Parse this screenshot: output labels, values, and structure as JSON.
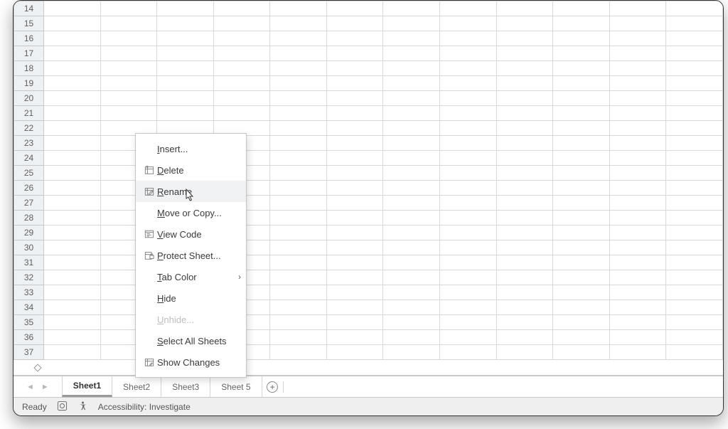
{
  "rows": [
    14,
    15,
    16,
    17,
    18,
    19,
    20,
    21,
    22,
    23,
    24,
    25,
    26,
    27,
    28,
    29,
    30,
    31,
    32,
    33,
    34,
    35,
    36,
    37
  ],
  "sheets": [
    {
      "name": "Sheet1",
      "active": true
    },
    {
      "name": "Sheet2",
      "active": false
    },
    {
      "name": "Sheet3",
      "active": false
    },
    {
      "name": "Sheet 5",
      "active": false
    }
  ],
  "status": {
    "ready": "Ready",
    "accessibility": "Accessibility: Investigate"
  },
  "menu": {
    "insert": "Insert...",
    "delete": "Delete",
    "rename": "Rename",
    "move_copy": "Move or Copy...",
    "view_code": "View Code",
    "protect": "Protect Sheet...",
    "tab_color": "Tab Color",
    "hide": "Hide",
    "unhide": "Unhide...",
    "select_all": "Select All Sheets",
    "show_changes": "Show Changes"
  }
}
